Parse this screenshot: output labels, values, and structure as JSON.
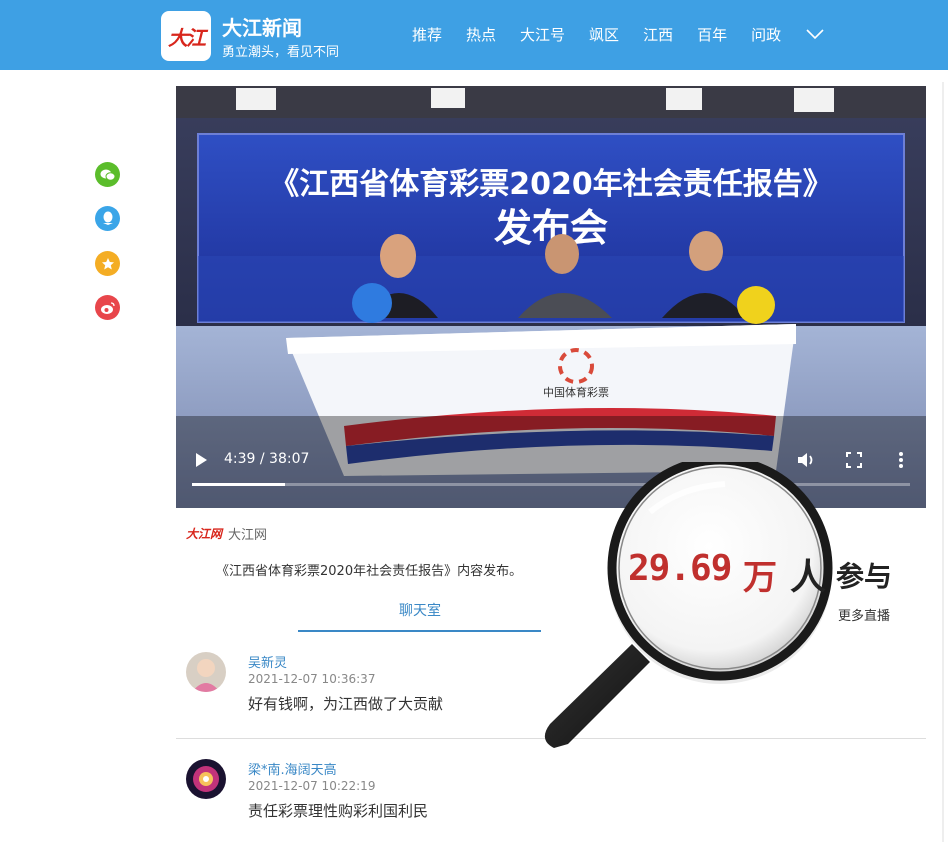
{
  "header": {
    "logo_text": "大江",
    "brand_name": "大江新闻",
    "slogan": "勇立潮头，看见不同",
    "nav": [
      "推荐",
      "热点",
      "大江号",
      "飒区",
      "江西",
      "百年",
      "问政"
    ]
  },
  "video": {
    "banner_line1": "《江西省体育彩票2020年社会责任报告》",
    "banner_line2": "发布会",
    "desk_logo": "中国体育彩票",
    "time": "4:39 / 38:07",
    "progress": 0.13
  },
  "article": {
    "source_logo": "大江网",
    "source_name": "大江网",
    "description": "《江西省体育彩票2020年社会责任报告》内容发布。",
    "chat_tab": "聊天室",
    "more_live": "更多直播"
  },
  "magnifier": {
    "count": "29.69",
    "unit": "万",
    "ren": "人",
    "join": "参与"
  },
  "comments": [
    {
      "user": "吴新灵",
      "time": "2021-12-07 10:36:37",
      "text": "好有钱啊，为江西做了大贡献"
    },
    {
      "user": "梁*南.海阔天高",
      "time": "2021-12-07 10:22:19",
      "text": "责任彩票理性购彩利国利民"
    }
  ],
  "colors": {
    "header": "#3ea0e4",
    "accent": "#3a88c6",
    "count": "#c0302e"
  }
}
